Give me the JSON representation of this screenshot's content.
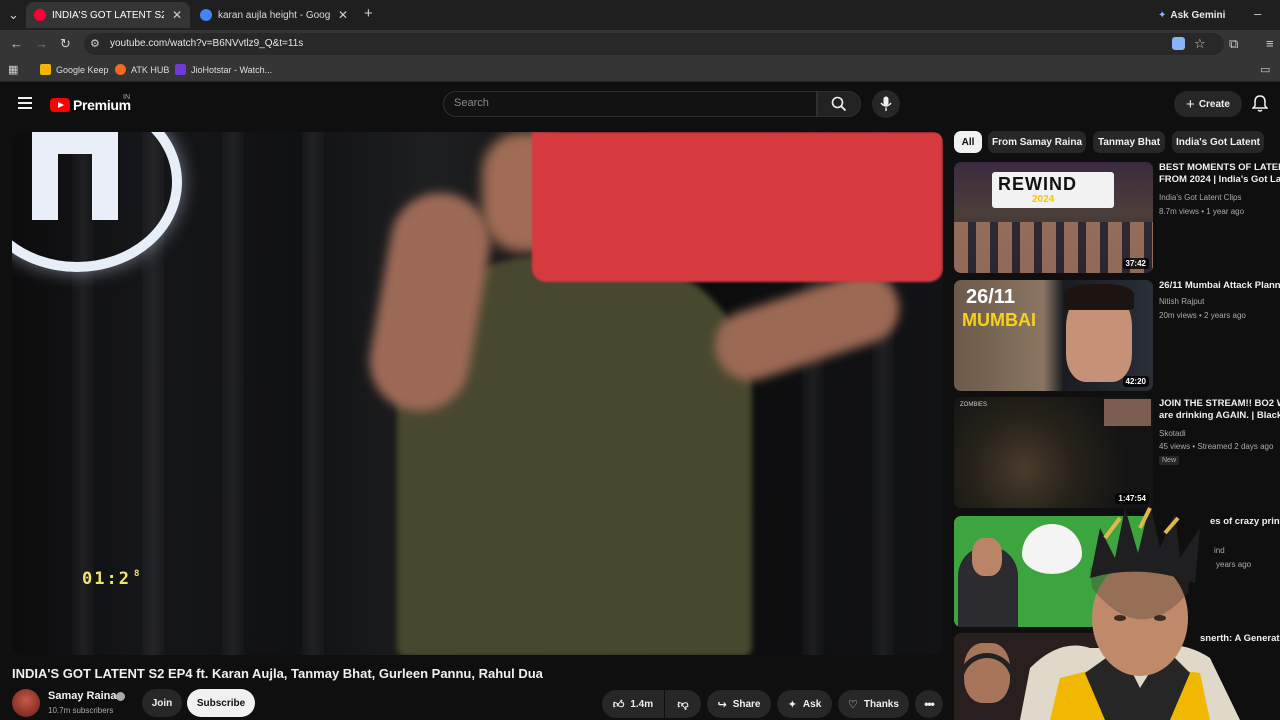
{
  "browser": {
    "tabs": [
      {
        "title": "INDIA'S GOT LATENT S2 EP4 ft.",
        "active": true,
        "favicon_color": "#ff0033"
      },
      {
        "title": "karan aujla height - Google Sea",
        "active": false,
        "favicon_color": "#4285f4"
      }
    ],
    "new_tab": "+",
    "ask_gemini": "Ask Gemini",
    "url": "youtube.com/watch?v=B6NVvtlz9_Q&t=11s",
    "bookmarks": [
      {
        "label": "Google Keep",
        "color": "#f6b400"
      },
      {
        "label": "ATK HUB",
        "color": "#f46a1f"
      },
      {
        "label": "JioHotstar - Watch...",
        "color": "#6c3bd8"
      }
    ]
  },
  "header": {
    "logo_text": "Premium",
    "country": "IN",
    "search_placeholder": "Search",
    "create_label": "Create"
  },
  "player": {
    "timecode": "01:2",
    "timecode_small": "8"
  },
  "video": {
    "title": "INDIA'S GOT LATENT S2 EP4 ft. Karan Aujla, Tanmay Bhat, Gurleen Pannu, Rahul Dua",
    "channel": "Samay Raina",
    "subscribers": "10.7m subscribers",
    "join_label": "Join",
    "subscribe_label": "Subscribe",
    "likes": "1.4m",
    "share_label": "Share",
    "ask_label": "Ask",
    "thanks_label": "Thanks"
  },
  "sidebar": {
    "chips": [
      "All",
      "From Samay Raina",
      "Tanmay Bhat",
      "India's Got Latent"
    ],
    "recommendations": [
      {
        "title": "BEST MOMENTS OF LATENT",
        "title2": "FROM 2024 | India's Got Lat",
        "channel": "India's Got Latent Clips",
        "meta": "8.7m views • 1 year ago",
        "duration": "37:42",
        "thumb_text": "REWIND",
        "thumb_text2": "2024"
      },
      {
        "title": "26/11 Mumbai Attack Plann",
        "channel": "Nitish Rajput",
        "meta": "20m views • 2 years ago",
        "duration": "42:20",
        "thumb_text": "26/11",
        "thumb_text2": "MUMBAI"
      },
      {
        "title": "JOIN THE STREAM!! BO2 W",
        "title2": "are drinking AGAIN. | Black",
        "channel": "Skotadi",
        "meta": "45 views • Streamed 2 days ago",
        "badge": "New",
        "duration": "1:47:54",
        "thumb_text": "ZOMBIES"
      },
      {
        "title": "es of crazy printer",
        "channel": "ind",
        "meta": "years ago"
      },
      {
        "title": "snerth: A Generati"
      }
    ]
  }
}
